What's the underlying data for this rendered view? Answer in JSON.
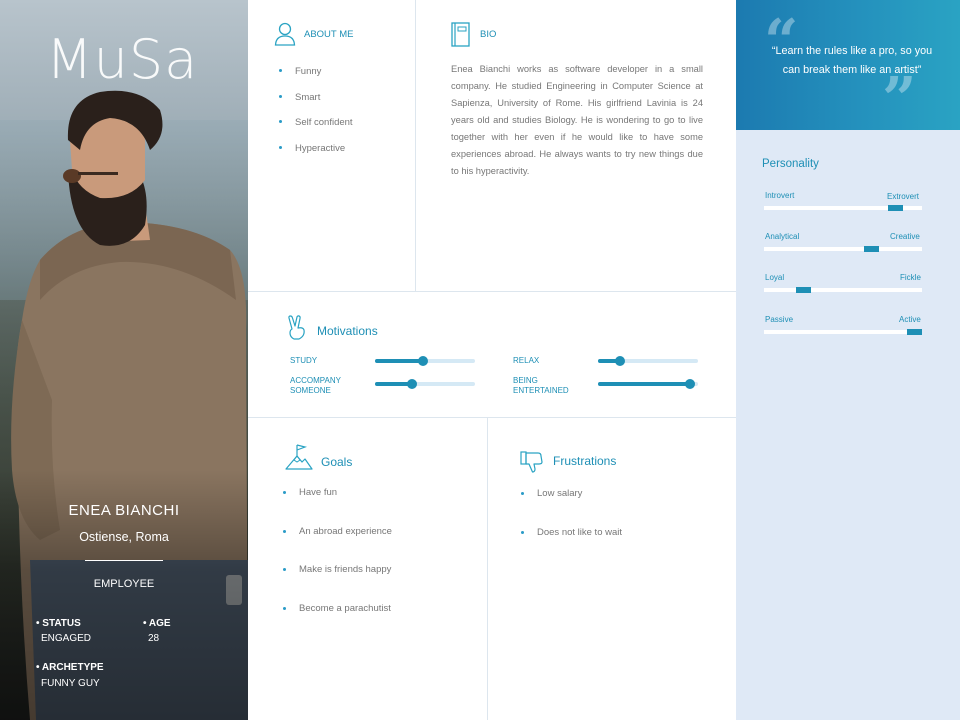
{
  "persona": {
    "title": "MuSa",
    "name": "ENEA BIANCHI",
    "location": "Ostiense, Roma",
    "role": "EMPLOYEE",
    "status_label": "• STATUS",
    "status_value": "ENGAGED",
    "age_label": "• AGE",
    "age_value": "28",
    "archetype_label": "• ARCHETYPE",
    "archetype_value": "FUNNY GUY"
  },
  "about_me": {
    "title": "ABOUT ME",
    "items": [
      "Funny",
      "Smart",
      "Self confident",
      "Hyperactive"
    ]
  },
  "bio": {
    "title": "BIO",
    "text": "Enea Bianchi works as software developer in a small company. He studied Engineering in Computer Science at Sapienza, University of Rome. His girlfriend Lavinia is 24 years old and studies Biology. He is wondering to go to live together with her even if he would like to have some experiences abroad. He always wants to try new things due to his hyperactivity."
  },
  "motivations": {
    "title": "Motivations",
    "items": [
      {
        "label": "STUDY",
        "level": 0.48
      },
      {
        "label": "ACCOMPANY SOMEONE",
        "level": 0.37
      },
      {
        "label": "RELAX",
        "level": 0.22
      },
      {
        "label": "BEING ENTERTAINED",
        "level": 0.92
      }
    ]
  },
  "goals": {
    "title": "Goals",
    "items": [
      "Have fun",
      "An abroad experience",
      "Make is friends happy",
      "Become a parachutist"
    ]
  },
  "frustrations": {
    "title": "Frustrations",
    "items": [
      "Low salary",
      "Does not like to wait"
    ]
  },
  "quote": {
    "text": "“Learn the rules like a pro, so you can break them like an artist”"
  },
  "personality": {
    "title": "Personality",
    "traits": [
      {
        "left": "Introvert",
        "right": "Extrovert",
        "level": 0.83
      },
      {
        "left": "Analytical",
        "right": "Creative",
        "level": 0.68
      },
      {
        "left": "Loyal",
        "right": "Fickle",
        "level": 0.25
      },
      {
        "left": "Passive",
        "right": "Active",
        "level": 0.95
      }
    ]
  },
  "colors": {
    "accent": "#1e8fb5",
    "track": "#d5e9f5",
    "right_panel_bg": "#dfe9f6",
    "quote_bg": "#2491bd"
  },
  "icons": [
    "user-icon",
    "book-icon",
    "peace-hand-icon",
    "mountain-flag-icon",
    "thumbs-down-icon",
    "quote-open-icon",
    "quote-close-icon"
  ]
}
